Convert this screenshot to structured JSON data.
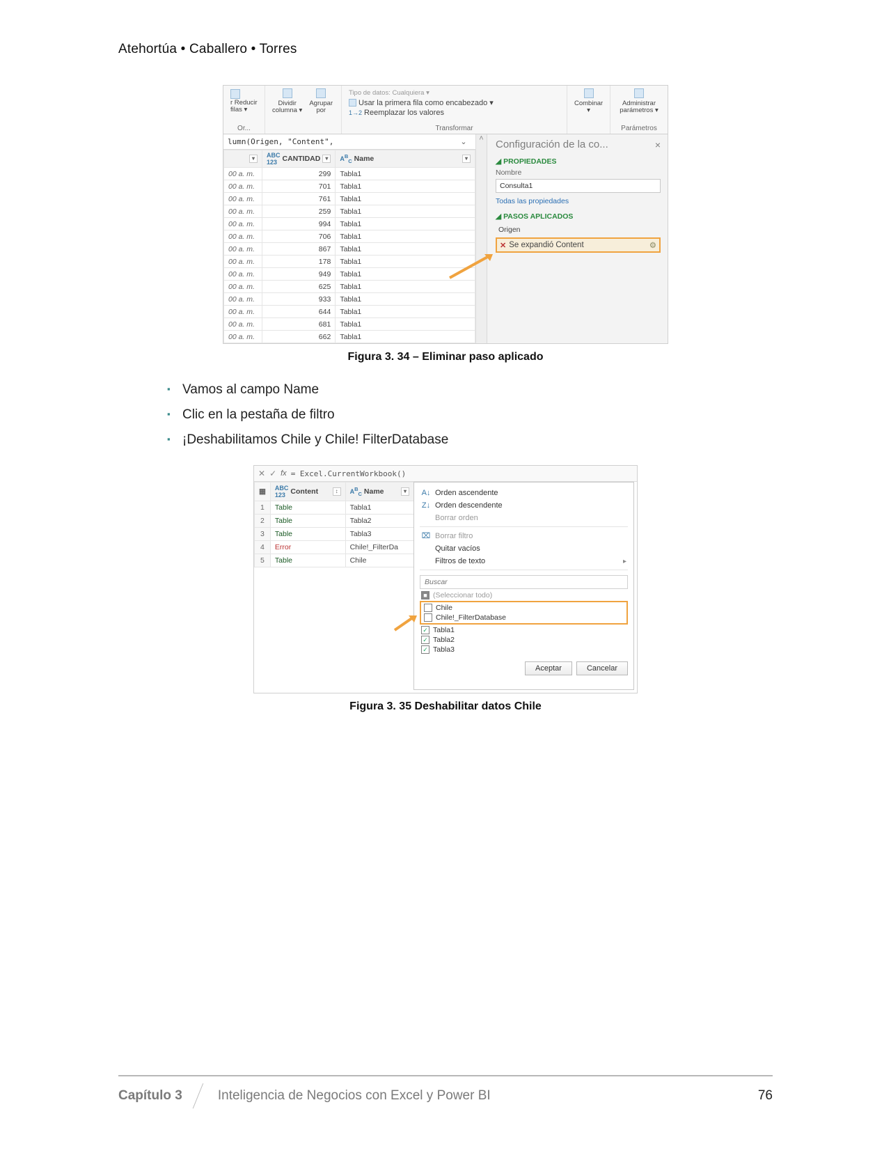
{
  "header": {
    "authors": "Atehortúa • Caballero • Torres"
  },
  "fig34": {
    "ribbon": {
      "reducir": "Reducir\nfilas ▾",
      "dividir": "Dividir\ncolumna ▾",
      "agrupar": "Agrupar\npor",
      "or_label": "Or...",
      "tipo": "Tipo de datos: Cualquiera ▾",
      "primefila": "Usar la primera fila como encabezado ▾",
      "reemplazar": "Reemplazar los valores",
      "transform_label": "Transformar",
      "combinar": "Combinar\n▾",
      "administrar": "Administrar\nparámetros ▾",
      "param_label": "Parámetros"
    },
    "formula": "lumn(Origen, \"Content\",",
    "columns": {
      "time_hdr": "",
      "cantidad": "CANTIDAD",
      "name": "Name"
    },
    "rows": [
      {
        "t": "00 a. m.",
        "c": "299",
        "n": "Tabla1"
      },
      {
        "t": "00 a. m.",
        "c": "701",
        "n": "Tabla1"
      },
      {
        "t": "00 a. m.",
        "c": "761",
        "n": "Tabla1"
      },
      {
        "t": "00 a. m.",
        "c": "259",
        "n": "Tabla1"
      },
      {
        "t": "00 a. m.",
        "c": "994",
        "n": "Tabla1"
      },
      {
        "t": "00 a. m.",
        "c": "706",
        "n": "Tabla1"
      },
      {
        "t": "00 a. m.",
        "c": "867",
        "n": "Tabla1"
      },
      {
        "t": "00 a. m.",
        "c": "178",
        "n": "Tabla1"
      },
      {
        "t": "00 a. m.",
        "c": "949",
        "n": "Tabla1"
      },
      {
        "t": "00 a. m.",
        "c": "625",
        "n": "Tabla1"
      },
      {
        "t": "00 a. m.",
        "c": "933",
        "n": "Tabla1"
      },
      {
        "t": "00 a. m.",
        "c": "644",
        "n": "Tabla1"
      },
      {
        "t": "00 a. m.",
        "c": "681",
        "n": "Tabla1"
      },
      {
        "t": "00 a. m.",
        "c": "662",
        "n": "Tabla1"
      }
    ],
    "panel": {
      "title": "Configuración de la co...",
      "prop_section": "PROPIEDADES",
      "nombre_label": "Nombre",
      "nombre_value": "Consulta1",
      "todas_link": "Todas las propiedades",
      "pasos_section": "PASOS APLICADOS",
      "step_origen": "Origen",
      "step_expand": "Se expandió Content"
    },
    "caption": "Figura 3. 34 – Eliminar paso aplicado"
  },
  "bullets": {
    "b1": "Vamos al campo Name",
    "b2": "Clic en la pestaña de filtro",
    "b3": "¡Deshabilitamos Chile y Chile! FilterDatabase"
  },
  "fig35": {
    "formula": "= Excel.CurrentWorkbook()",
    "cols": {
      "content": "Content",
      "name": "Name"
    },
    "rows": [
      {
        "i": "1",
        "c": "Table",
        "n": "Tabla1"
      },
      {
        "i": "2",
        "c": "Table",
        "n": "Tabla2"
      },
      {
        "i": "3",
        "c": "Table",
        "n": "Tabla3"
      },
      {
        "i": "4",
        "c": "Error",
        "n": "Chile!_FilterDa"
      },
      {
        "i": "5",
        "c": "Table",
        "n": "Chile"
      }
    ],
    "popup": {
      "asc": "Orden ascendente",
      "desc": "Orden descendente",
      "borrar_orden": "Borrar orden",
      "borrar_filtro": "Borrar filtro",
      "quitar": "Quitar vacíos",
      "textfilters": "Filtros de texto",
      "search_ph": "Buscar",
      "sel_all": "(Seleccionar todo)",
      "chile": "Chile",
      "chile_fd": "Chile!_FilterDatabase",
      "t1": "Tabla1",
      "t2": "Tabla2",
      "t3": "Tabla3",
      "ok": "Aceptar",
      "cancel": "Cancelar"
    },
    "caption": "Figura 3. 35 Deshabilitar datos Chile"
  },
  "footer": {
    "chapter": "Capítulo 3",
    "title": "Inteligencia de Negocios con Excel y Power BI",
    "page": "76"
  }
}
